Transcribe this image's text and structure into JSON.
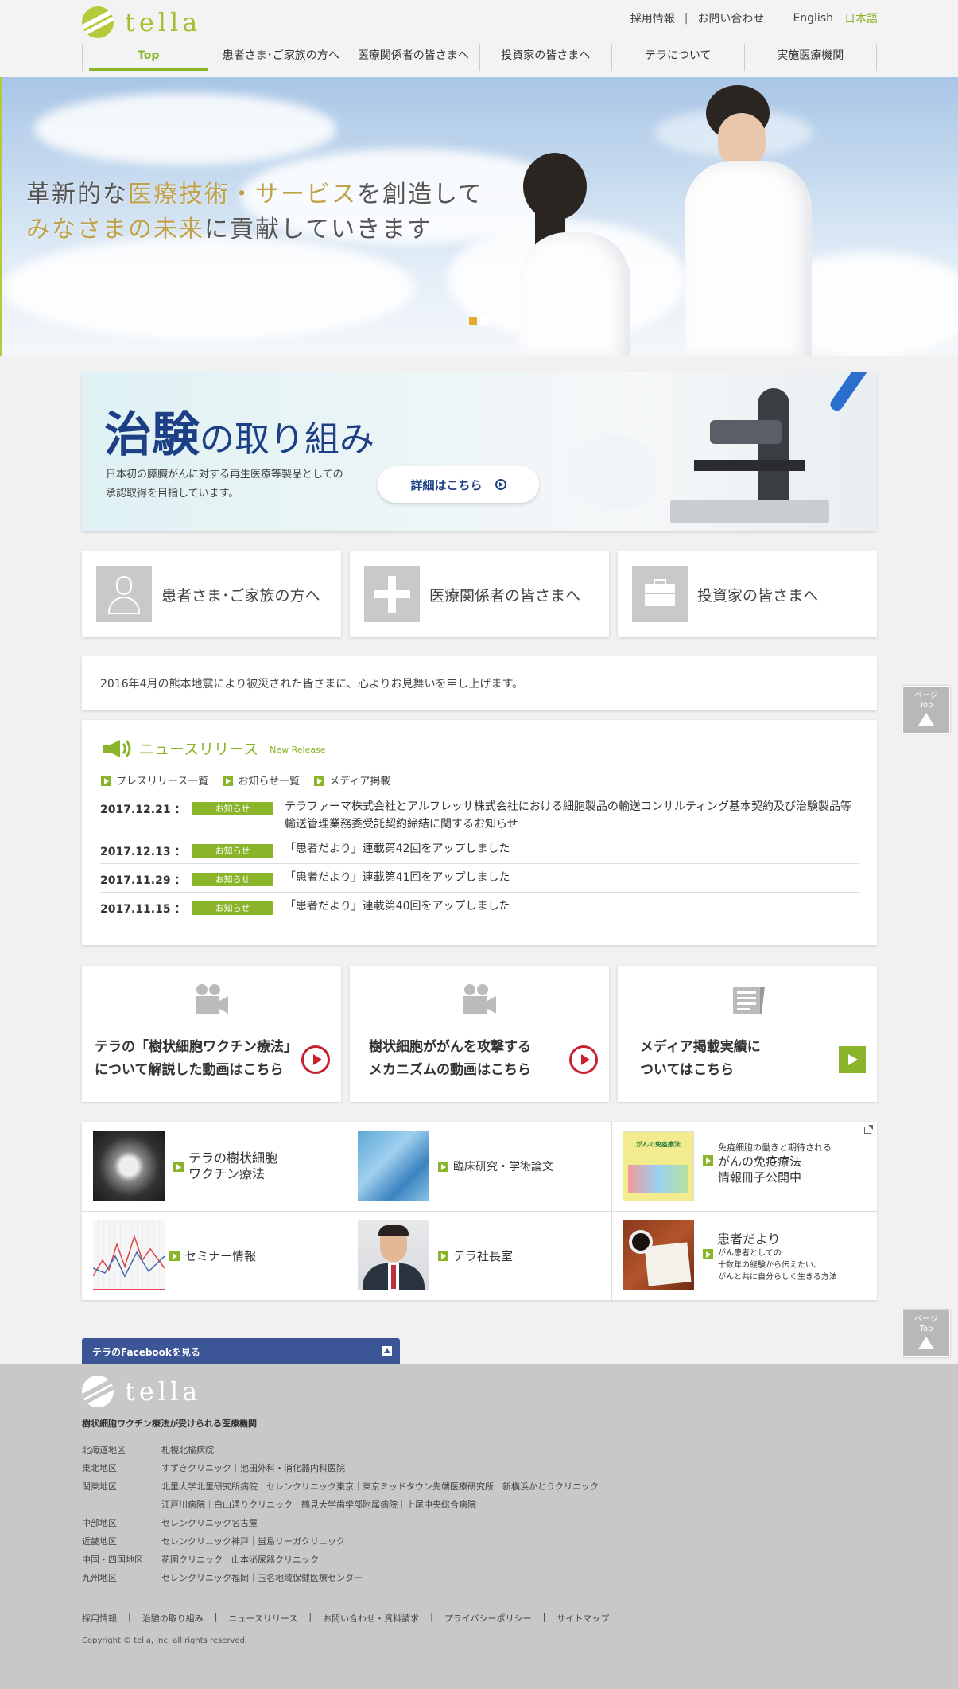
{
  "brand": {
    "logo_text": "tella"
  },
  "top_links": {
    "recruit": "採用情報",
    "separator": "|",
    "contact": "お問い合わせ",
    "english": "English",
    "japanese": "日本語"
  },
  "global_nav": [
    {
      "label": "Top",
      "active": true
    },
    {
      "label": "患者さま･ご家族の方へ",
      "active": false
    },
    {
      "label": "医療関係者の皆さまへ",
      "active": false
    },
    {
      "label": "投資家の皆さまへ",
      "active": false
    },
    {
      "label": "テラについて",
      "active": false
    },
    {
      "label": "実施医療機関",
      "active": false
    }
  ],
  "hero": {
    "line1_a": "革新的な",
    "line1_b": "医療技術・サービス",
    "line1_c": "を創造して",
    "line2_a": "みなさまの未来",
    "line2_b": "に貢献していきます",
    "slides": 2,
    "current_slide": 1
  },
  "trial": {
    "title_big1": "治験",
    "title_mid1": "の",
    "title_big2": "取り組み",
    "desc_line1": "日本初の膵臓がんに対する再生医療等製品としての",
    "desc_line2": "承認取得を目指しています。",
    "button": "詳細はこちら"
  },
  "audience": [
    {
      "label": "患者さま･ご家族の方へ",
      "icon": "person-icon"
    },
    {
      "label": "医療関係者の皆さまへ",
      "icon": "plus-icon"
    },
    {
      "label": "投資家の皆さまへ",
      "icon": "briefcase-icon"
    }
  ],
  "notice": "2016年4月の熊本地震により被災された皆さまに、心よりお見舞いを申し上げます。",
  "news": {
    "title": "ニュースリリース",
    "subtitle": "New Release",
    "links": [
      "プレスリリース一覧",
      "お知らせ一覧",
      "メディア掲載"
    ],
    "items": [
      {
        "date": "2017.12.21 ：",
        "badge": "お知らせ",
        "text_line1": "テラファーマ株式会社とアルフレッサ株式会社における細胞製品の輸送コンサルティング基本契約及び治験製品等",
        "text_line2": "輸送管理業務委受託契約締結に関するお知らせ"
      },
      {
        "date": "2017.12.13 ：",
        "badge": "お知らせ",
        "text_line1": "「患者だより」連載第42回をアップしました",
        "text_line2": ""
      },
      {
        "date": "2017.11.29 ：",
        "badge": "お知らせ",
        "text_line1": "「患者だより」連載第41回をアップしました",
        "text_line2": ""
      },
      {
        "date": "2017.11.15 ：",
        "badge": "お知らせ",
        "text_line1": "「患者だより」連載第40回をアップしました",
        "text_line2": ""
      }
    ]
  },
  "video_cards": [
    {
      "line1": "テラの「樹状細胞ワクチン療法」",
      "line2": "について解説した動画はこちら",
      "icon": "video-camera-icon"
    },
    {
      "line1": "樹状細胞ががんを攻撃する",
      "line2": "メカニズムの動画はこちら",
      "icon": "video-camera-icon"
    },
    {
      "line1": "メディア掲載実績に",
      "line2": "ついてはこちら",
      "icon": "newspaper-icon"
    }
  ],
  "link_grid": [
    {
      "line1": "テラの樹状細胞",
      "line2": "ワクチン療法"
    },
    {
      "line1": "臨床研究・学術論文",
      "line2": ""
    },
    {
      "pre": "免疫細胞の働きと期待される",
      "line1": "がんの免疫療法",
      "line2": "情報冊子公開中",
      "booklet_title": "がんの免疫療法"
    },
    {
      "line1": "セミナー情報",
      "line2": ""
    },
    {
      "line1": "テラ社長室",
      "line2": ""
    },
    {
      "line1": "患者だより",
      "sub1": "がん患者としての",
      "sub2": "十数年の経験から伝えたい、",
      "sub3": "がんと共に自分らしく生きる方法"
    }
  ],
  "page_top": {
    "line1": "ページ",
    "line2": "Top"
  },
  "facebook": {
    "label": "テラのFacebookを見る"
  },
  "footer": {
    "heading": "樹状細胞ワクチン療法が受けられる医療機関",
    "regions": [
      {
        "name": "北海道地区",
        "clinics": "札幌北楡病院"
      },
      {
        "name": "東北地区",
        "clinics": "すずきクリニック｜池田外科・消化器内科医院"
      },
      {
        "name": "関東地区",
        "clinics": "北里大学北里研究所病院｜セレンクリニック東京｜東京ミッドタウン先端医療研究所｜新横浜かとうクリニック｜"
      },
      {
        "name": "",
        "clinics": "江戸川病院｜白山通りクリニック｜鶴見大学歯学部附属病院｜上尾中央総合病院"
      },
      {
        "name": "中部地区",
        "clinics": "セレンクリニック名古屋"
      },
      {
        "name": "近畿地区",
        "clinics": "セレンクリニック神戸｜蛍島リーガクリニック"
      },
      {
        "name": "中国・四国地区",
        "clinics": "花園クリニック｜山本泌尿器クリニック"
      },
      {
        "name": "九州地区",
        "clinics": "セレンクリニック福岡｜玉名地域保健医療センター"
      }
    ],
    "links": [
      "採用情報",
      "治験の取り組み",
      "ニュースリリース",
      "お問い合わせ・資料請求",
      "プライバシーポリシー",
      "サイトマップ"
    ],
    "link_sep": "|",
    "copyright": "Copyright © tella, inc. all rights reserved."
  },
  "colors": {
    "accent": "#8ab52a",
    "navy": "#1c3f86",
    "red": "#c8202e",
    "facebook": "#3b5596"
  }
}
